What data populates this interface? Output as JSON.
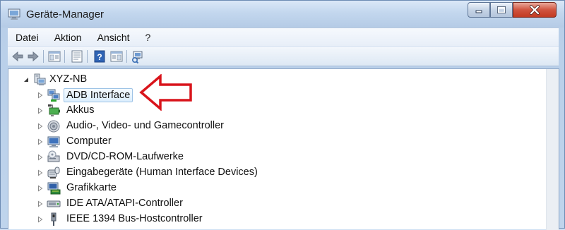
{
  "window": {
    "title": "Geräte-Manager",
    "icons": {
      "app": "device-manager-icon",
      "min": "minimize-icon",
      "max": "maximize-icon",
      "close": "close-icon"
    }
  },
  "menu": {
    "items": [
      "Datei",
      "Aktion",
      "Ansicht",
      "?"
    ]
  },
  "toolbar": {
    "icons": [
      "back-arrow-icon",
      "forward-arrow-icon",
      "show-hide-console-tree-icon",
      "properties-icon",
      "help-icon",
      "action-pane-icon",
      "scan-hardware-icon"
    ]
  },
  "tree": {
    "root": {
      "label": "XYZ-NB",
      "icon": "computer-icon",
      "expanded": true
    },
    "children": [
      {
        "label": "ADB Interface",
        "icon": "adb-interface-icon",
        "selected": true
      },
      {
        "label": "Akkus",
        "icon": "battery-icon"
      },
      {
        "label": "Audio-, Video- und Gamecontroller",
        "icon": "speaker-icon"
      },
      {
        "label": "Computer",
        "icon": "monitor-icon"
      },
      {
        "label": "DVD/CD-ROM-Laufwerke",
        "icon": "dvd-drive-icon"
      },
      {
        "label": "Eingabegeräte (Human Interface Devices)",
        "icon": "hid-icon"
      },
      {
        "label": "Grafikkarte",
        "icon": "display-adapter-icon"
      },
      {
        "label": "IDE ATA/ATAPI-Controller",
        "icon": "ide-controller-icon"
      },
      {
        "label": "IEEE 1394 Bus-Hostcontroller",
        "icon": "firewire-icon"
      }
    ]
  },
  "annotation": {
    "icon": "red-arrow-annotation-icon",
    "color": "#d9141b"
  },
  "colors": {
    "accent": "#9ec3e6",
    "selection": "#dceefd"
  }
}
